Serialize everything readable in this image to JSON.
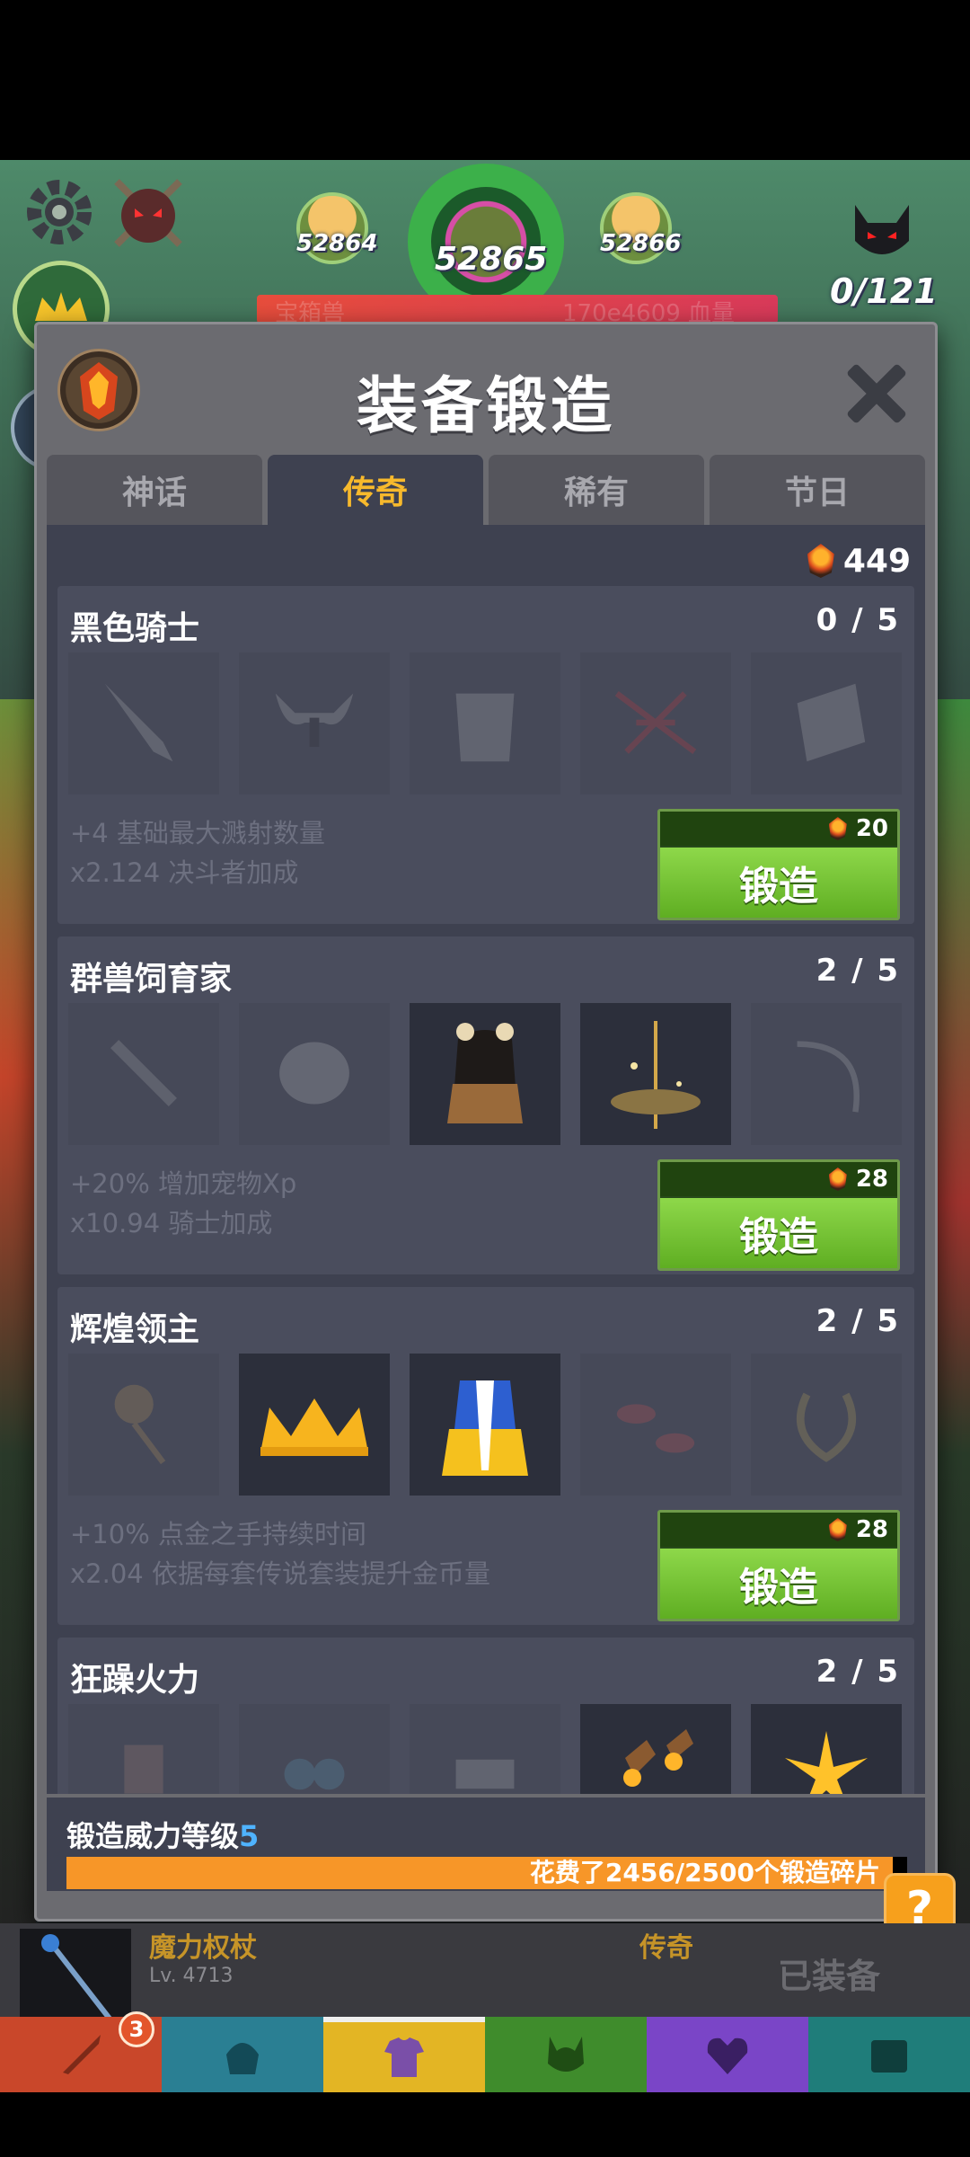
{
  "hud": {
    "stage_prev": "52864",
    "stage_current": "52865",
    "stage_next": "52866",
    "boss_label": "宝箱兽",
    "boss_hp": "170e4609 血量",
    "kill_counter": "0/121"
  },
  "modal": {
    "title": "装备锻造",
    "tabs": [
      "神话",
      "传奇",
      "稀有",
      "节日"
    ],
    "active_tab": "传奇",
    "shard_count": "449",
    "sets": [
      {
        "name": "黑色骑士",
        "progress": "0 / 5",
        "bonus1": "+4 基础最大溅射数量",
        "bonus2": "x2.124 决斗者加成",
        "cost": "20",
        "forge_label": "锻造",
        "items": [
          {
            "icon": "broadsword-icon",
            "owned": false
          },
          {
            "icon": "horned-helmet-icon",
            "owned": false
          },
          {
            "icon": "dark-armor-icon",
            "owned": false
          },
          {
            "icon": "red-rune-icon",
            "owned": false
          },
          {
            "icon": "cape-icon",
            "owned": false
          }
        ]
      },
      {
        "name": "群兽饲育家",
        "progress": "2 / 5",
        "bonus1": "+20% 增加宠物Xp",
        "bonus2": "x10.94 骑士加成",
        "cost": "28",
        "forge_label": "锻造",
        "items": [
          {
            "icon": "spiked-club-icon",
            "owned": false
          },
          {
            "icon": "beast-hood-icon",
            "owned": false
          },
          {
            "icon": "beast-armor-icon",
            "owned": true
          },
          {
            "icon": "golden-aura-icon",
            "owned": true
          },
          {
            "icon": "bow-icon",
            "owned": false
          }
        ]
      },
      {
        "name": "辉煌领主",
        "progress": "2 / 5",
        "bonus1": "+10% 点金之手持续时间",
        "bonus2": "x2.04 依据每套传说套装提升金币量",
        "cost": "28",
        "forge_label": "锻造",
        "items": [
          {
            "icon": "golden-rose-icon",
            "owned": false
          },
          {
            "icon": "crown-icon",
            "owned": true
          },
          {
            "icon": "royal-robe-icon",
            "owned": true
          },
          {
            "icon": "petals-icon",
            "owned": false
          },
          {
            "icon": "laurel-icon",
            "owned": false
          }
        ]
      },
      {
        "name": "狂躁火力",
        "progress": "2 / 5",
        "bonus1": "",
        "bonus2": "",
        "cost": "",
        "forge_label": "",
        "items": [
          {
            "icon": "top-hat-icon",
            "owned": false
          },
          {
            "icon": "goggles-icon",
            "owned": false
          },
          {
            "icon": "cannon-icon",
            "owned": false
          },
          {
            "icon": "rockets-icon",
            "owned": true
          },
          {
            "icon": "spark-icon",
            "owned": true
          }
        ]
      }
    ],
    "power": {
      "label": "锻造威力等级",
      "level": "5",
      "spent_text": "花费了2456/2500个锻造碎片",
      "spent": 2456,
      "total": 2500
    }
  },
  "help_label": "?",
  "equipped": {
    "name": "魔力权杖",
    "level": "Lv. 4713",
    "rarity": "传奇",
    "status": "已装备"
  },
  "bottom_nav": {
    "tabs": [
      {
        "icon": "sword-icon",
        "color": "#c9472a",
        "badge": "3"
      },
      {
        "icon": "helmet-icon",
        "color": "#2a7f93",
        "badge": ""
      },
      {
        "icon": "armor-icon",
        "color": "#e3b524",
        "badge": ""
      },
      {
        "icon": "horned-helmet-icon",
        "color": "#3f8c2c",
        "badge": ""
      },
      {
        "icon": "heart-icon",
        "color": "#7a45c7",
        "badge": ""
      },
      {
        "icon": "chest-icon",
        "color": "#1f7d7a",
        "badge": ""
      }
    ]
  },
  "colors": {
    "accent_gold": "#f7b92c",
    "forge_green": "#7bc93a",
    "progress_orange": "#f79628",
    "level_blue": "#4fb3ff"
  }
}
